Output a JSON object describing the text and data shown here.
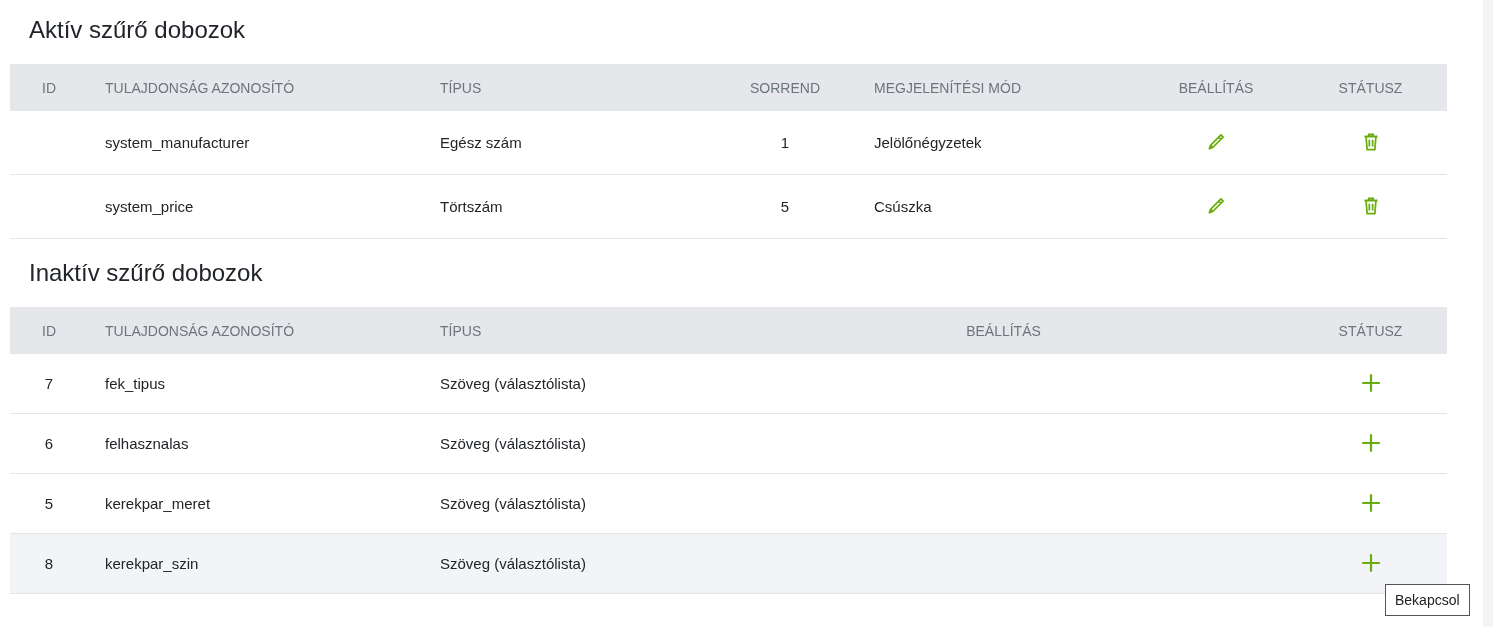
{
  "sections": [
    {
      "title": "Aktív szűrő dobozok",
      "kind": "active",
      "columns": [
        {
          "label": "ID",
          "kind": "id"
        },
        {
          "label": "TULAJDONSÁG AZONOSÍTÓ",
          "kind": "text"
        },
        {
          "label": "TÍPUS",
          "kind": "text"
        },
        {
          "label": "SORREND",
          "kind": "center"
        },
        {
          "label": "MEGJELENÍTÉSI MÓD",
          "kind": "text"
        },
        {
          "label": "BEÁLLÍTÁS",
          "kind": "center"
        },
        {
          "label": "STÁTUSZ",
          "kind": "center"
        }
      ],
      "rows": [
        {
          "hovered": false,
          "cells": [
            "",
            "system_manufacturer",
            "Egész szám",
            "1",
            "Jelölőnégyzetek",
            {
              "kind": "edit"
            },
            {
              "kind": "delete"
            }
          ]
        },
        {
          "hovered": false,
          "cells": [
            "",
            "system_price",
            "Törtszám",
            "5",
            "Csúszka",
            {
              "kind": "edit"
            },
            {
              "kind": "delete"
            }
          ]
        }
      ]
    },
    {
      "title": "Inaktív szűrő dobozok",
      "kind": "inactive",
      "columns": [
        {
          "label": "ID",
          "kind": "id"
        },
        {
          "label": "TULAJDONSÁG AZONOSÍTÓ",
          "kind": "text"
        },
        {
          "label": "TÍPUS",
          "kind": "text"
        },
        {
          "label": "BEÁLLÍTÁS",
          "kind": "center"
        },
        {
          "label": "STÁTUSZ",
          "kind": "center"
        }
      ],
      "rows": [
        {
          "hovered": false,
          "cells": [
            "7",
            "fek_tipus",
            "Szöveg (választólista)",
            "",
            {
              "kind": "enable"
            }
          ]
        },
        {
          "hovered": false,
          "cells": [
            "6",
            "felhasznalas",
            "Szöveg (választólista)",
            "",
            {
              "kind": "enable"
            }
          ]
        },
        {
          "hovered": false,
          "cells": [
            "5",
            "kerekpar_meret",
            "Szöveg (választólista)",
            "",
            {
              "kind": "enable"
            }
          ]
        },
        {
          "hovered": true,
          "cells": [
            "8",
            "kerekpar_szin",
            "Szöveg (választólista)",
            "",
            {
              "kind": "enable"
            }
          ]
        }
      ]
    }
  ],
  "tooltip": {
    "text": "Bekapcsol"
  }
}
